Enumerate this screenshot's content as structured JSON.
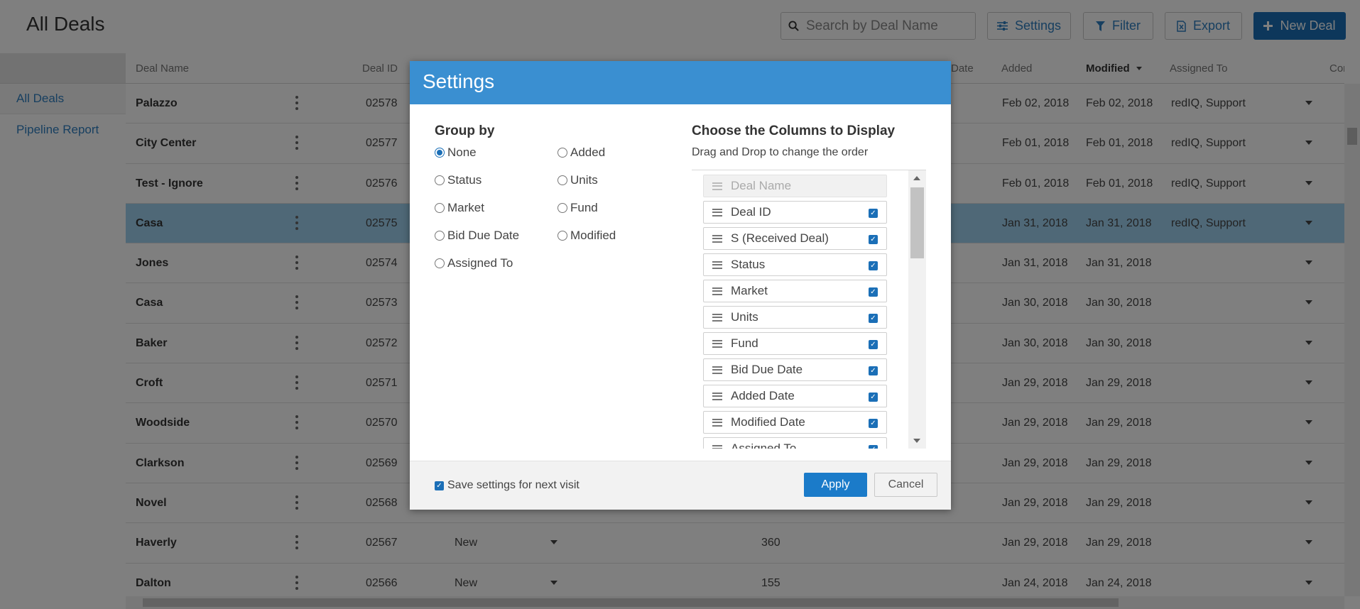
{
  "header": {
    "title": "All Deals",
    "search_placeholder": "Search by Deal Name",
    "settings_label": "Settings",
    "filter_label": "Filter",
    "export_label": "Export",
    "new_deal_label": "New Deal"
  },
  "sidebar": {
    "items": [
      {
        "label": "All Deals"
      },
      {
        "label": "Pipeline Report"
      }
    ]
  },
  "grid": {
    "columns": [
      "Deal Name",
      "Deal ID",
      "Date",
      "Added",
      "Modified",
      "Assigned To",
      "Comm"
    ],
    "rows": [
      {
        "name": "Palazzo",
        "id": "02578",
        "status": "",
        "units": "",
        "added": "Feb 02, 2018",
        "modified": "Feb 02, 2018",
        "assigned": "redIQ, Support"
      },
      {
        "name": "City Center",
        "id": "02577",
        "status": "",
        "units": "",
        "added": "Feb 01, 2018",
        "modified": "Feb 01, 2018",
        "assigned": "redIQ, Support"
      },
      {
        "name": "Test - Ignore",
        "id": "02576",
        "status": "",
        "units": "",
        "added": "Feb 01, 2018",
        "modified": "Feb 01, 2018",
        "assigned": "redIQ, Support"
      },
      {
        "name": "Casa",
        "id": "02575",
        "status": "",
        "units": "",
        "added": "Jan 31, 2018",
        "modified": "Jan 31, 2018",
        "assigned": "redIQ, Support"
      },
      {
        "name": "Jones",
        "id": "02574",
        "status": "",
        "units": "",
        "added": "Jan 31, 2018",
        "modified": "Jan 31, 2018",
        "assigned": ""
      },
      {
        "name": "Casa",
        "id": "02573",
        "status": "",
        "units": "",
        "added": "Jan 30, 2018",
        "modified": "Jan 30, 2018",
        "assigned": ""
      },
      {
        "name": "Baker",
        "id": "02572",
        "status": "",
        "units": "",
        "added": "Jan 30, 2018",
        "modified": "Jan 30, 2018",
        "assigned": ""
      },
      {
        "name": "Croft",
        "id": "02571",
        "status": "",
        "units": "",
        "added": "Jan 29, 2018",
        "modified": "Jan 29, 2018",
        "assigned": ""
      },
      {
        "name": "Woodside",
        "id": "02570",
        "status": "",
        "units": "",
        "added": "Jan 29, 2018",
        "modified": "Jan 29, 2018",
        "assigned": ""
      },
      {
        "name": "Clarkson",
        "id": "02569",
        "status": "",
        "units": "",
        "added": "Jan 29, 2018",
        "modified": "Jan 29, 2018",
        "assigned": ""
      },
      {
        "name": "Novel",
        "id": "02568",
        "status": "",
        "units": "",
        "added": "Jan 29, 2018",
        "modified": "Jan 29, 2018",
        "assigned": ""
      },
      {
        "name": "Haverly",
        "id": "02567",
        "status": "New",
        "units": "360",
        "added": "Jan 29, 2018",
        "modified": "Jan 29, 2018",
        "assigned": ""
      },
      {
        "name": "Dalton",
        "id": "02566",
        "status": "New",
        "units": "155",
        "added": "Jan 24, 2018",
        "modified": "Jan 24, 2018",
        "assigned": ""
      }
    ]
  },
  "modal": {
    "title": "Settings",
    "group_by_title": "Group by",
    "group_options": [
      "None",
      "Status",
      "Market",
      "Bid Due Date",
      "Assigned To",
      "Added",
      "Units",
      "Fund",
      "Modified"
    ],
    "selected_group": "None",
    "columns_title": "Choose the Columns to Display",
    "columns_subtitle": "Drag and Drop to change the order",
    "columns": [
      "Deal Name",
      "Deal ID",
      "S (Received Deal)",
      "Status",
      "Market",
      "Units",
      "Fund",
      "Bid Due Date",
      "Added Date",
      "Modified Date",
      "Assigned To"
    ],
    "save_label": "Save settings for next visit",
    "apply_label": "Apply",
    "cancel_label": "Cancel"
  },
  "colors": {
    "accent": "#1b6fb7",
    "modal_header": "#3a8fd1",
    "selected_row": "#9fd0ef"
  }
}
